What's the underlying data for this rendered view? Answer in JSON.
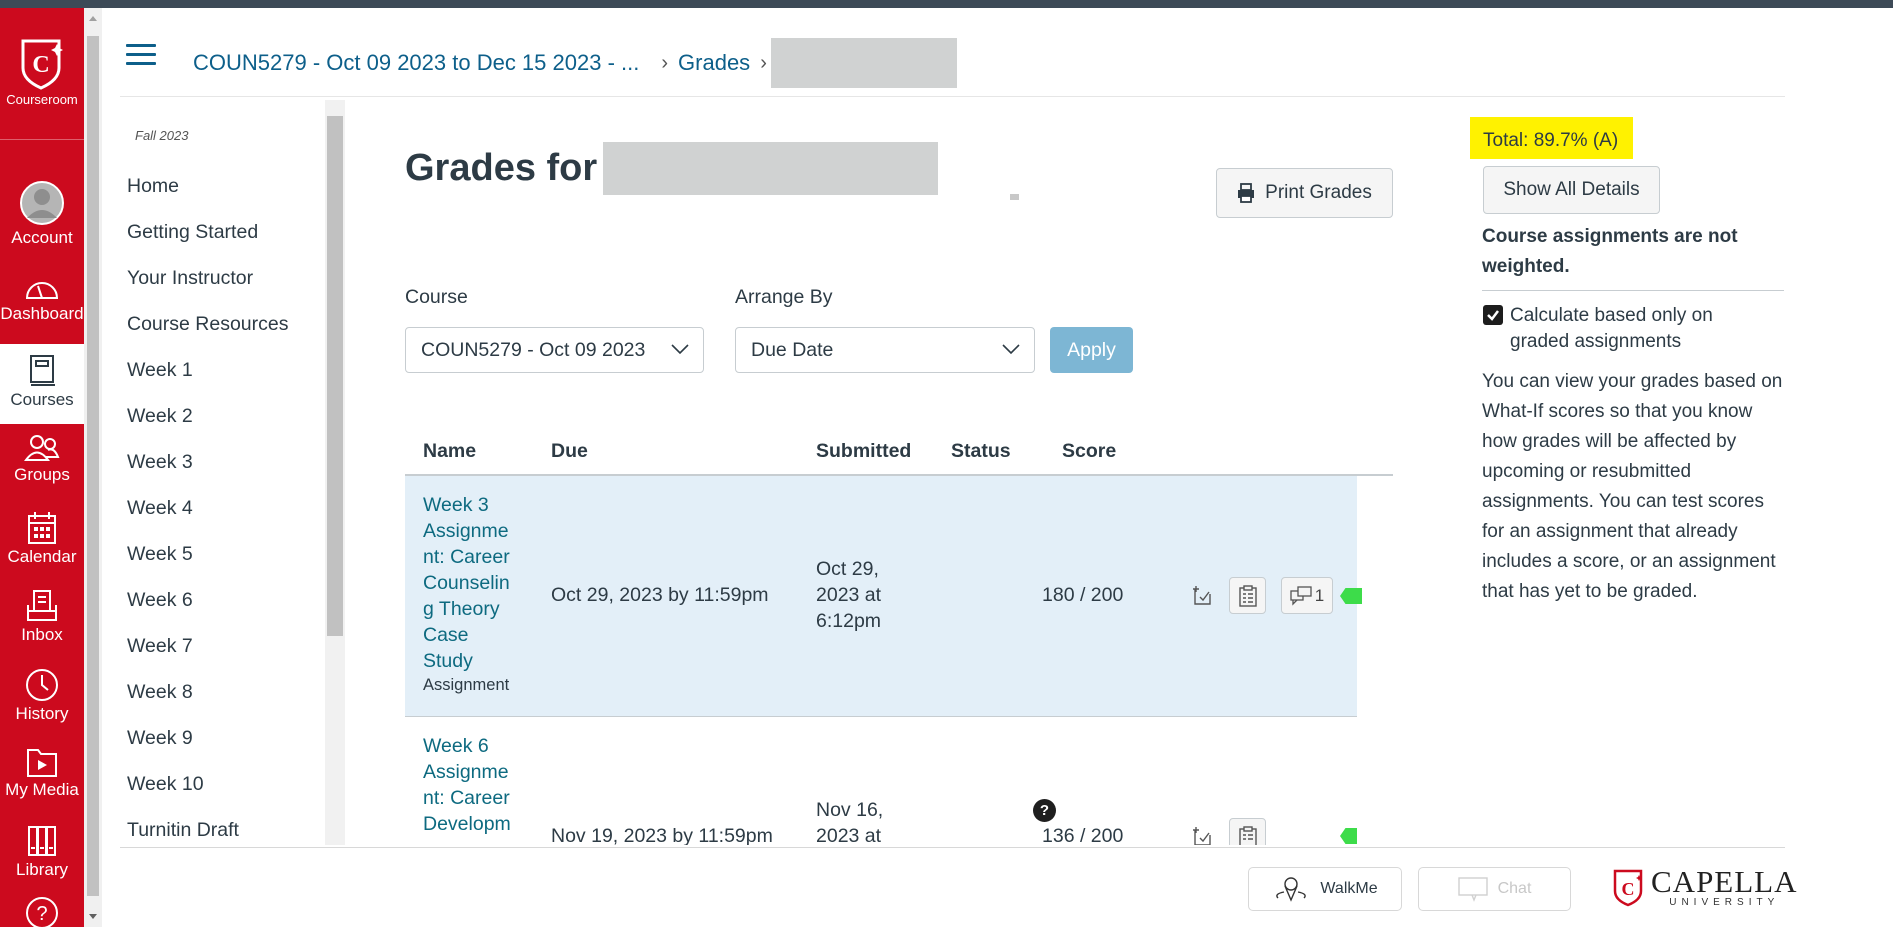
{
  "global_nav": {
    "logo_label": "Courseroom",
    "items": [
      {
        "label": "Account",
        "icon": "avatar-icon"
      },
      {
        "label": "Dashboard",
        "icon": "dashboard-icon"
      },
      {
        "label": "Courses",
        "icon": "courses-icon",
        "active": true
      },
      {
        "label": "Groups",
        "icon": "groups-icon"
      },
      {
        "label": "Calendar",
        "icon": "calendar-icon"
      },
      {
        "label": "Inbox",
        "icon": "inbox-icon"
      },
      {
        "label": "History",
        "icon": "history-icon"
      },
      {
        "label": "My Media",
        "icon": "media-icon"
      },
      {
        "label": "Library",
        "icon": "library-icon"
      },
      {
        "label": "Help",
        "icon": "help-icon"
      }
    ],
    "brand_color": "#cc0a1e"
  },
  "breadcrumb": {
    "course": "COUN5279 - Oct 09 2023 to Dec 15 2023 - ...",
    "grades": "Grades",
    "student": "[redacted]"
  },
  "course_nav": {
    "term": "Fall 2023",
    "items": [
      "Home",
      "Getting Started",
      "Your Instructor",
      "Course Resources",
      "Week 1",
      "Week 2",
      "Week 3",
      "Week 4",
      "Week 5",
      "Week 6",
      "Week 7",
      "Week 8",
      "Week 9",
      "Week 10",
      "Turnitin Draft"
    ]
  },
  "main": {
    "title": "Grades for",
    "print_button": "Print Grades",
    "course_label": "Course",
    "course_value": "COUN5279 - Oct 09 2023",
    "arrange_label": "Arrange By",
    "arrange_value": "Due Date",
    "apply_button": "Apply"
  },
  "table": {
    "headers": [
      "Name",
      "Due",
      "Submitted",
      "Status",
      "Score"
    ],
    "rows": [
      {
        "name": "Week 3 Assignment: Career Counseling Theory Case Study",
        "name_lines": [
          "Week 3",
          "Assignme",
          "nt: Career",
          "Counselin",
          "g Theory",
          "Case",
          "Study"
        ],
        "type": "Assignment",
        "due": "Oct 29, 2023 by 11:59pm",
        "submitted_lines": [
          "Oct 29,",
          "2023 at",
          "6:12pm"
        ],
        "status": "",
        "score": "180 / 200",
        "comment_count": "1"
      },
      {
        "name": "Week 6 Assignment: Career Developm...",
        "name_lines": [
          "Week 6",
          "Assignme",
          "nt: Career",
          "Developm"
        ],
        "due": "Nov 19, 2023 by 11:59pm",
        "submitted_lines": [
          "Nov 16,",
          "2023 at"
        ],
        "status": "?",
        "score": "136 / 200"
      }
    ]
  },
  "right_panel": {
    "total": "Total: 89.7% (A)",
    "show_all_details": "Show All Details",
    "weight_note": "Course assignments are not weighted.",
    "calc_checkbox_label": "Calculate based only on graded assignments",
    "calc_checked": true,
    "what_if_text": "You can view your grades based on What-If scores so that you know how grades will be affected by upcoming or resubmitted assignments. You can test scores for an assignment that already includes a score, or an assignment that has yet to be graded."
  },
  "footer": {
    "walkme": "WalkMe",
    "chat": "Chat",
    "brand": "CAPELLA",
    "brand_sub": "UNIVERSITY"
  }
}
